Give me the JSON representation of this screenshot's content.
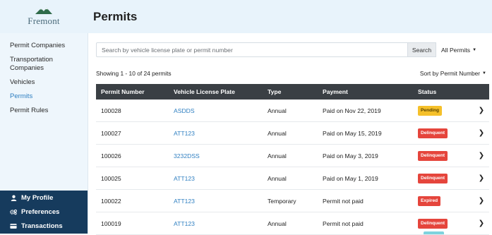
{
  "brand": {
    "logo_text": "Fremont"
  },
  "sidebar": {
    "items": [
      {
        "label": "Permit Companies",
        "active": false
      },
      {
        "label": "Transportation Companies",
        "active": false
      },
      {
        "label": "Vehicles",
        "active": false
      },
      {
        "label": "Permits",
        "active": true
      },
      {
        "label": "Permit Rules",
        "active": false
      }
    ],
    "bottom": [
      {
        "label": "My Profile",
        "icon": "user-icon"
      },
      {
        "label": "Preferences",
        "icon": "gears-icon"
      },
      {
        "label": "Transactions",
        "icon": "card-icon"
      }
    ]
  },
  "header": {
    "title": "Permits"
  },
  "search": {
    "placeholder": "Search by vehicle license plate or permit number",
    "button": "Search",
    "filter": "All Permits"
  },
  "summary": {
    "showing": "Showing 1 - 10 of 24 permits",
    "sort": "Sort by Permit Number"
  },
  "table": {
    "columns": [
      "Permit Number",
      "Vehicle License Plate",
      "Type",
      "Payment",
      "Status"
    ],
    "rows": [
      {
        "permit": "100028",
        "plate": "ASDDS",
        "type": "Annual",
        "payment": "Paid on Nov 22, 2019",
        "status": "Pending",
        "status_kind": "pending"
      },
      {
        "permit": "100027",
        "plate": "ATT123",
        "type": "Annual",
        "payment": "Paid on May 15, 2019",
        "status": "Delinquent",
        "status_kind": "delinquent"
      },
      {
        "permit": "100026",
        "plate": "3232DSS",
        "type": "Annual",
        "payment": "Paid on May 3, 2019",
        "status": "Delinquent",
        "status_kind": "delinquent"
      },
      {
        "permit": "100025",
        "plate": "ATT123",
        "type": "Annual",
        "payment": "Paid on May 1, 2019",
        "status": "Delinquent",
        "status_kind": "delinquent"
      },
      {
        "permit": "100022",
        "plate": "ATT123",
        "type": "Temporary",
        "payment": "Permit not paid",
        "status": "Expired",
        "status_kind": "expired"
      },
      {
        "permit": "100019",
        "plate": "ATT123",
        "type": "Annual",
        "payment": "Permit not paid",
        "status": "Delinquent",
        "status_kind": "delinquent"
      }
    ]
  },
  "colors": {
    "accent": "#2f7fc1",
    "sidebar_dark": "#163b5d",
    "table_header": "#3a3f44",
    "pending": "#f5c02a",
    "delinquent": "#e5453c"
  }
}
